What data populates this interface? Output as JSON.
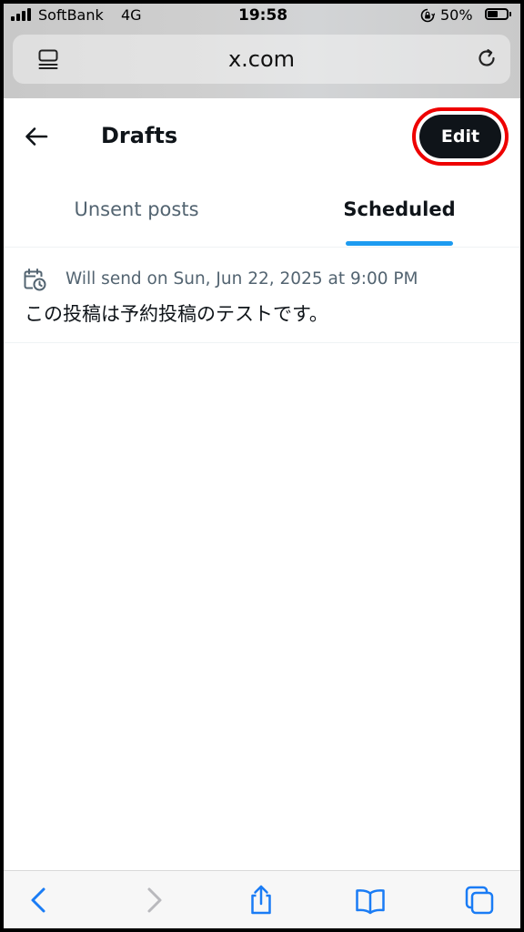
{
  "status_bar": {
    "carrier": "SoftBank",
    "network": "4G",
    "time": "19:58",
    "battery": "50%"
  },
  "browser": {
    "url": "x.com",
    "toolbar": [
      "back-icon",
      "forward-icon",
      "share-icon",
      "bookmarks-icon",
      "tabs-icon"
    ]
  },
  "header": {
    "title": "Drafts",
    "edit_label": "Edit"
  },
  "tabs": [
    {
      "label": "Unsent posts",
      "active": false
    },
    {
      "label": "Scheduled",
      "active": true
    }
  ],
  "scheduled_posts": [
    {
      "schedule": "Will send on Sun, Jun 22, 2025 at 9:00 PM",
      "text": "この投稿は予約投稿のテストです。"
    }
  ],
  "colors": {
    "accent": "#1d9bf0",
    "primary_text": "#0f1419",
    "secondary_text": "#536471",
    "highlight": "#ee0000"
  }
}
